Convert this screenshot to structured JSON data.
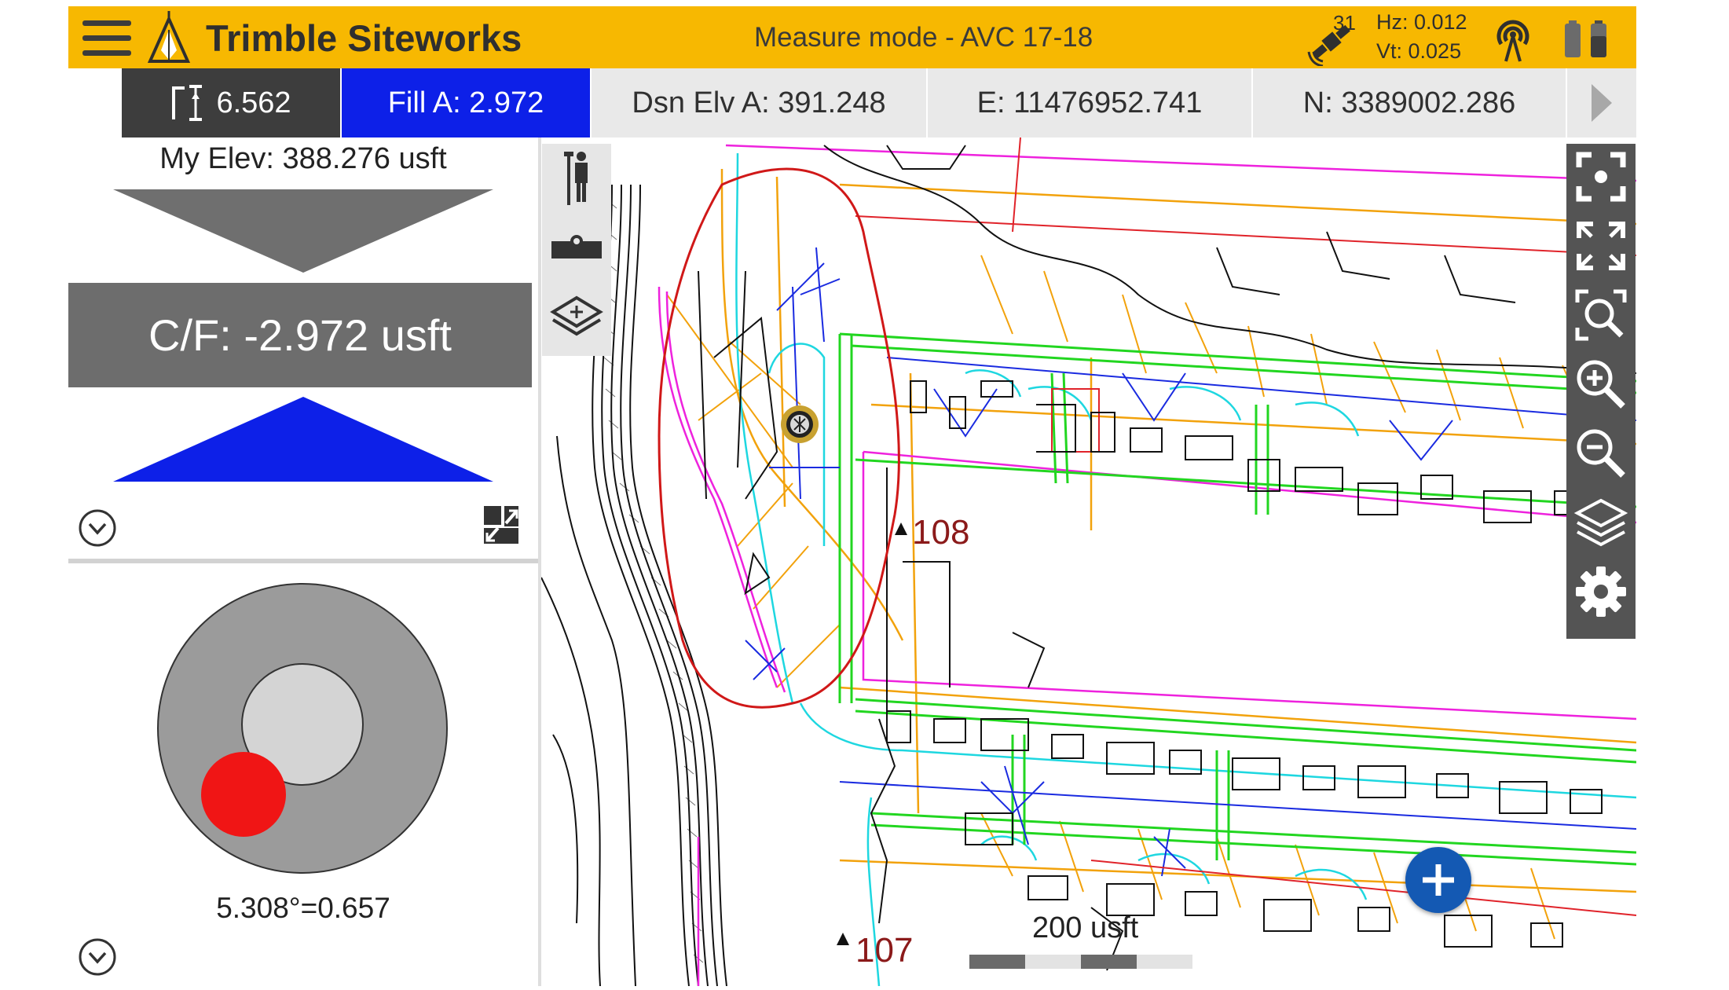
{
  "header": {
    "app_title": "Trimble Siteworks",
    "mode_label": "Measure mode - AVC 17-18",
    "satellite_count": "31",
    "hz_precision": "Hz: 0.012",
    "vt_precision": "Vt: 0.025"
  },
  "info_strip": {
    "antenna_height": "6.562",
    "fill": "Fill A: 2.972",
    "design_elevation": "Dsn Elv A: 391.248",
    "easting": "E: 11476952.741",
    "northing": "N: 3389002.286"
  },
  "left_panel": {
    "my_elevation": "My Elev: 388.276 usft",
    "cut_fill": "C/F: -2.972 usft",
    "tilt_readout": "5.308°=0.657"
  },
  "map": {
    "point_labels": [
      "108",
      "107"
    ],
    "scale_label": "200 usft"
  },
  "colors": {
    "header_yellow": "#f7b801",
    "fill_blue": "#0d20e8",
    "bubble_red": "#f01515",
    "add_button_blue": "#1459b3"
  },
  "icons": {
    "menu": "hamburger-icon",
    "logo": "trimble-plumb-bob-logo",
    "satellites": "satellite-icon",
    "radio": "radio-signal-icon",
    "batteries": "battery-icon",
    "antenna_height": "rod-height-icon",
    "map_tools_left": [
      "rover-icon",
      "level-tool-icon",
      "layers-add-icon"
    ],
    "map_tools_right": [
      "center-on-position-icon",
      "zoom-extents-icon",
      "zoom-window-icon",
      "zoom-in-icon",
      "zoom-out-icon",
      "layers-icon",
      "settings-gear-icon"
    ]
  }
}
